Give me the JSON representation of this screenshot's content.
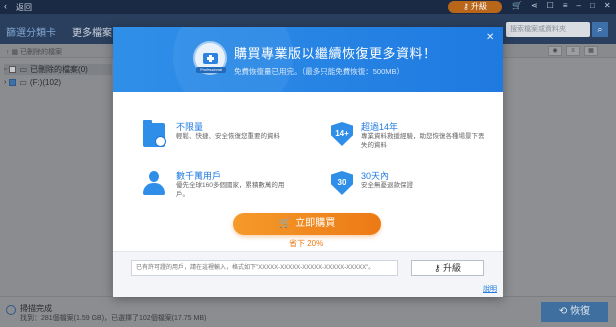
{
  "titlebar": {
    "back_icon": "chevron-left",
    "back_label": "返回",
    "upgrade_label": "升級",
    "upgrade_color": "#b8661a"
  },
  "nav": {
    "tabs": [
      "篩選分類卡",
      "更多檔案"
    ],
    "search_placeholder": "搜索檔案或資料夾"
  },
  "subbar": {
    "crumb": "已刪除的檔案"
  },
  "sidebar": {
    "items": [
      {
        "label": "已刪除的檔案(0)"
      },
      {
        "label": "(F:)(102)"
      }
    ]
  },
  "status": {
    "title": "掃描完成",
    "detail": "找到：281個檔案(1.59 GB)，已選擇了102個檔案(17.75 MB)",
    "recover_label": "恢復"
  },
  "modal": {
    "title": "購買專業版以繼續恢復更多資料！",
    "subtitle": "免費恢復量已用完。（最多只能免費恢復：500MB）",
    "close_icon": "close",
    "logo_ribbon": "Professional",
    "features": [
      {
        "icon": "folder-recover",
        "title": "不限量",
        "desc": "輕鬆、快捷、安全恢復您重要的資料"
      },
      {
        "icon": "shield-14",
        "badge": "14+",
        "title": "超過14年",
        "desc": "專業資料救援經驗，助您恢復各種場景下丟失的資料"
      },
      {
        "icon": "user",
        "title": "數千萬用戶",
        "desc": "優先全球160多個國家，累積數萬的用戶。"
      },
      {
        "icon": "shield-30",
        "badge": "30",
        "title": "30天內",
        "desc": "安全無憂退款保證"
      }
    ],
    "buy_label": "立即購買",
    "discount": "省下 20%",
    "key_placeholder": "已有許可證的用戶，請在這裡輸入，格式如下\"XXXXX-XXXXX-XXXXX-XXXXX-XXXXX\"。",
    "key_button_label": "升級",
    "help_label": "說明",
    "accent": "#1f7ae0",
    "buy_color": "#ec7a16"
  }
}
